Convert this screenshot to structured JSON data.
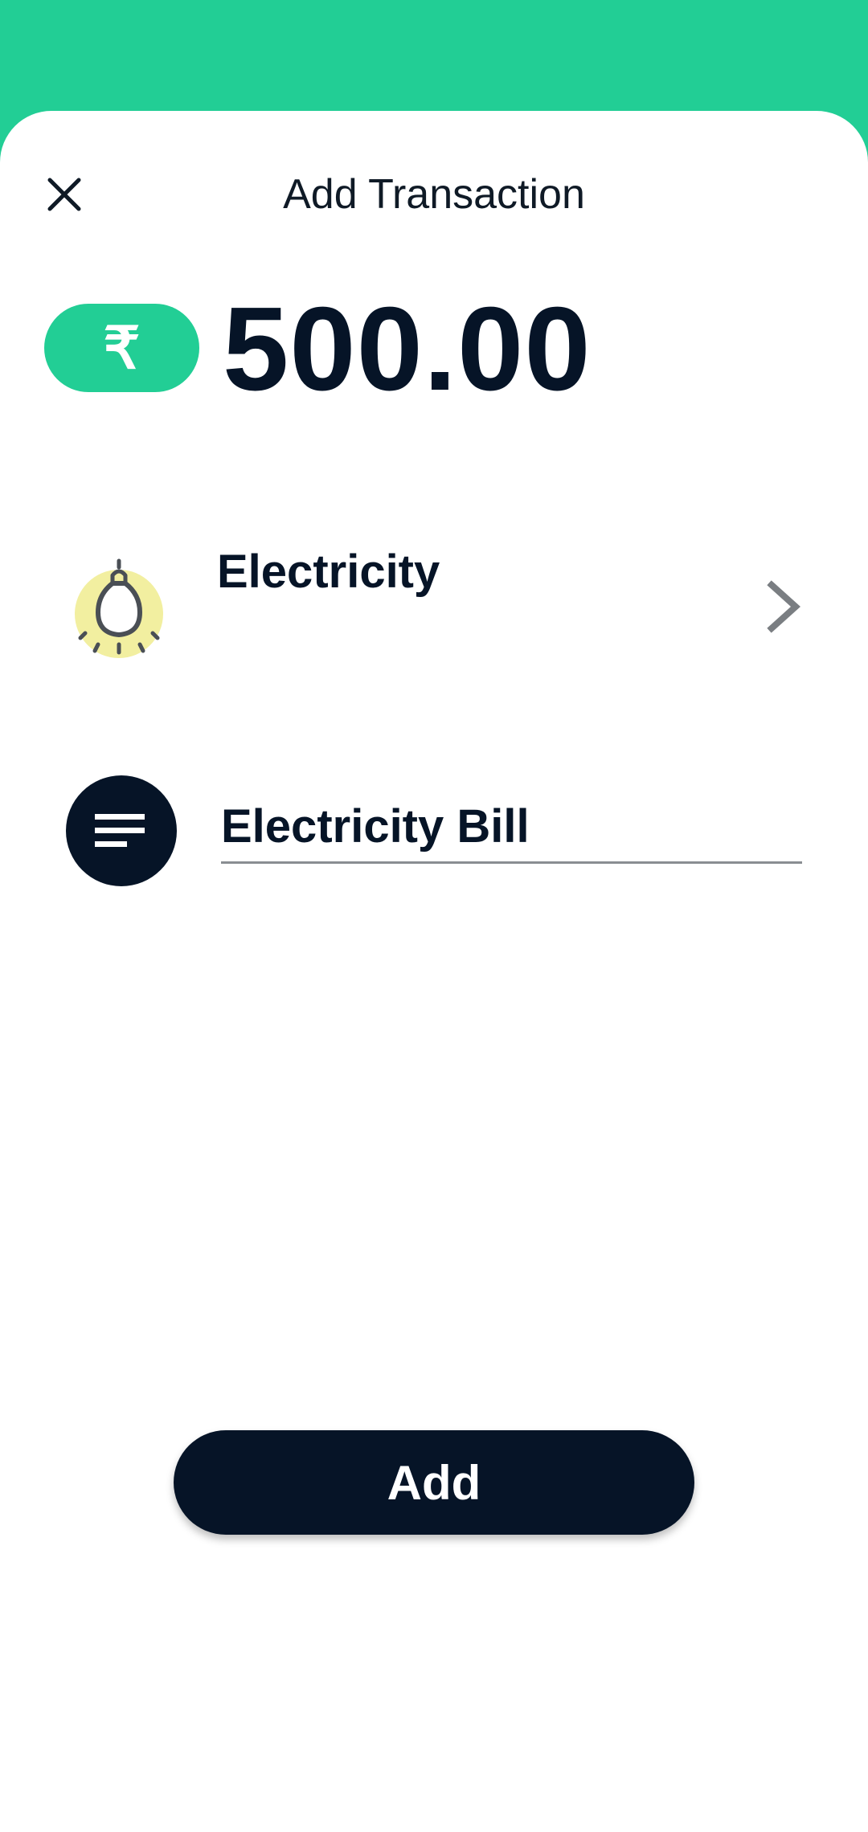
{
  "colors": {
    "accent": "#22CE95",
    "dark": "#061427",
    "bulb_bg": "#F2EFA0"
  },
  "header": {
    "title": "Add Transaction",
    "close_icon": "close-icon"
  },
  "amount": {
    "currency_symbol": "₹",
    "value": "500.00"
  },
  "category": {
    "icon": "lightbulb-icon",
    "label": "Electricity",
    "chevron_icon": "chevron-right-icon"
  },
  "note": {
    "icon": "notes-icon",
    "value": "Electricity Bill"
  },
  "actions": {
    "add_label": "Add"
  }
}
